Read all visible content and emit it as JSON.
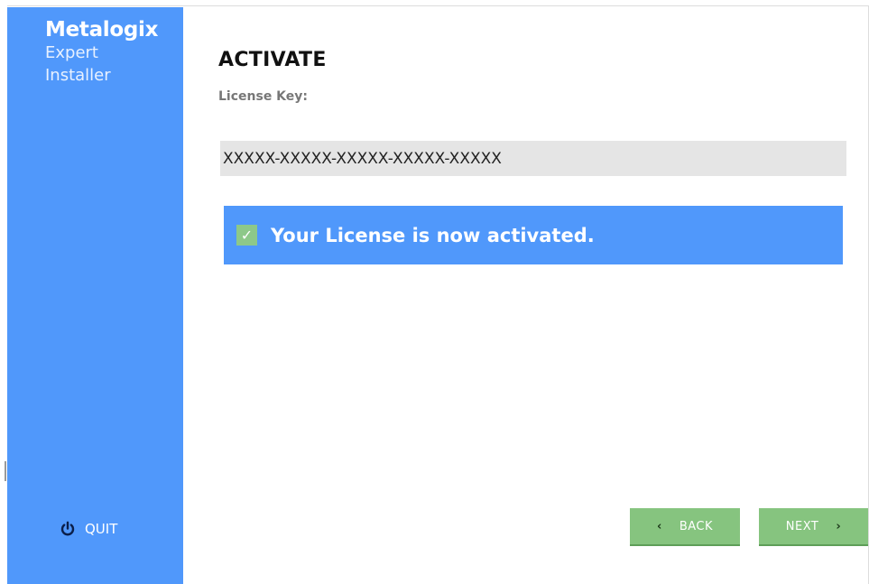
{
  "sidebar": {
    "brand": {
      "name": "Metalogix",
      "line2": "Expert",
      "line3": "Installer"
    },
    "quit": {
      "icon": "power-icon",
      "label": "QUIT"
    },
    "color": "#5098fb"
  },
  "main": {
    "title": "ACTIVATE",
    "license_label": "License Key:",
    "license_value": "XXXXX-XXXXX-XXXXX-XXXXX-XXXXX",
    "status": {
      "icon": "check-icon",
      "check_glyph": "✓",
      "message": "Your License is now activated.",
      "color": "#5098fb",
      "check_color": "#8dc889"
    }
  },
  "footer": {
    "back_chevron": "‹",
    "back_label": "BACK",
    "next_label": "NEXT",
    "next_chevron": "›",
    "button_color": "#86c47f"
  }
}
